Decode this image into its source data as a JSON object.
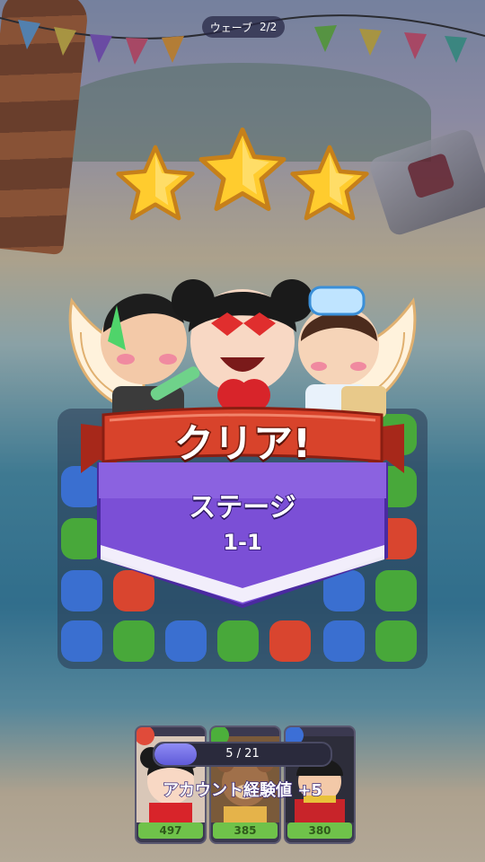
{
  "hud": {
    "wave_label": "ウェーブ",
    "wave_progress": "2/2"
  },
  "result": {
    "stars_earned": 3,
    "stars_total": 3,
    "title": "クリア!",
    "stage_label": "ステージ",
    "stage_number": "1-1"
  },
  "rewards": {
    "xp_progress_text": "5 / 21",
    "xp_current": 5,
    "xp_max": 21,
    "account_xp_label": "アカウント経験値 +5"
  },
  "party": [
    {
      "name": "pucca-card",
      "element_icon": "fire-icon",
      "element_color": "#e04b3a",
      "hp": "497"
    },
    {
      "name": "bear-card",
      "element_icon": "leaf-icon",
      "element_color": "#4caf3b",
      "hp": "385"
    },
    {
      "name": "garu-card",
      "element_icon": "water-icon",
      "element_color": "#3c6fd6",
      "hp": "380"
    }
  ],
  "colors": {
    "ribbon_red": "#d8432b",
    "banner_purple": "#7b4fd6",
    "star_gold": "#ffcc2e",
    "hp_green": "#6fc24a"
  }
}
